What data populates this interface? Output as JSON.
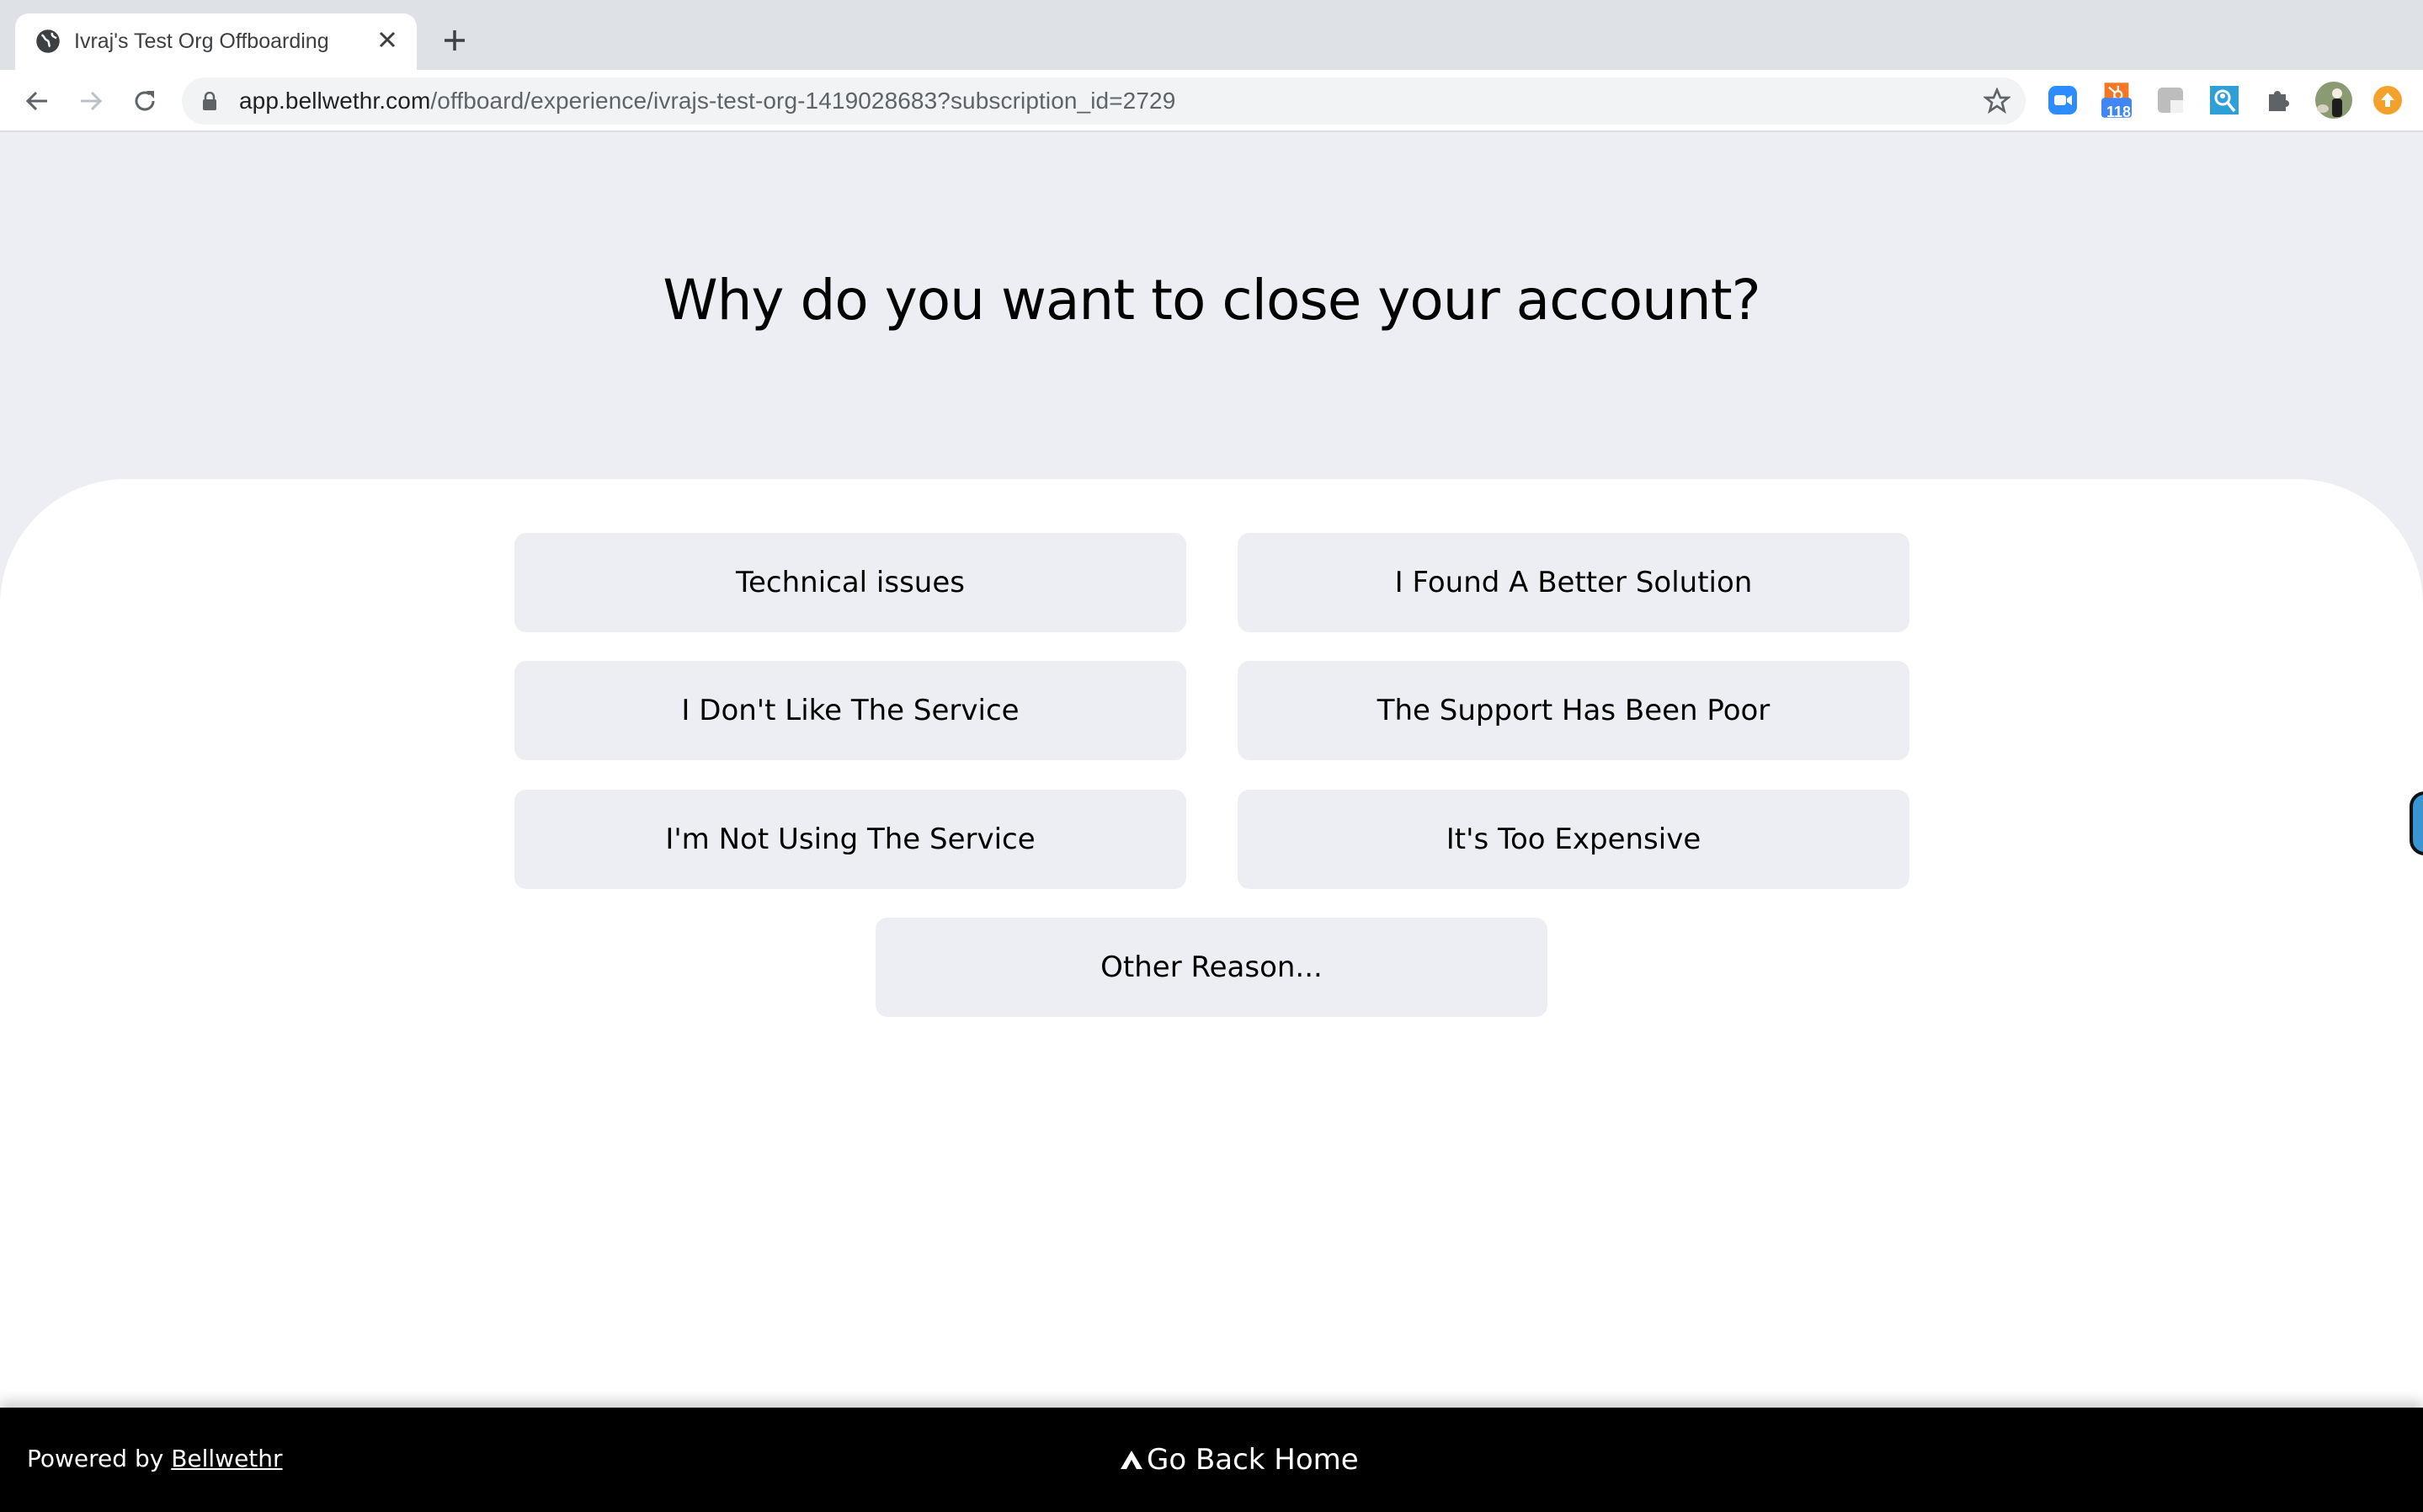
{
  "browser": {
    "tab": {
      "title": "Ivraj's Test Org Offboarding",
      "icon": "globe-icon",
      "close_icon": "close-icon"
    },
    "new_tab_icon": "plus-icon",
    "nav": {
      "back_icon": "arrow-left-icon",
      "forward_icon": "arrow-right-icon",
      "reload_icon": "reload-icon"
    },
    "address": {
      "host": "app.bellwethr.com",
      "path": "/offboard/experience/ivrajs-test-org-1419028683?subscription_id=2729",
      "lock_icon": "lock-icon",
      "bookmark_icon": "star-icon"
    },
    "extensions": [
      {
        "name": "zoom-extension",
        "icon": "video-camera-icon",
        "color": "#2d8cff"
      },
      {
        "name": "hubspot-extension",
        "icon": "hubspot-icon",
        "color": "#f57722",
        "badge": "118",
        "badge_color": "#4285f4"
      },
      {
        "name": "gray-extension",
        "icon": "square-icon",
        "color": "#bdbdbd"
      },
      {
        "name": "search-person-extension",
        "icon": "search-person-icon",
        "color": "#2e9fd8"
      },
      {
        "name": "extensions-menu",
        "icon": "puzzle-icon",
        "color": "#5f6368"
      },
      {
        "name": "profile-avatar",
        "icon": "avatar-icon",
        "color": "#7a8a6a"
      },
      {
        "name": "update-button",
        "icon": "arrow-up-circle-icon",
        "color": "#f4a12b"
      }
    ]
  },
  "page": {
    "heading": "Why do you want to close your account?",
    "reasons": [
      "Technical issues",
      "I Found A Better Solution",
      "I Don't Like The Service",
      "The Support Has Been Poor",
      "I'm Not Using The Service",
      "It's Too Expensive",
      "Other Reason..."
    ]
  },
  "footer": {
    "powered_prefix": "Powered by ",
    "powered_link": "Bellwethr",
    "go_home": "Go Back Home",
    "go_home_icon": "chevron-up-icon"
  },
  "colors": {
    "page_bg": "#eceef3",
    "button_bg": "#eceef3",
    "footer_bg": "#000000",
    "side_tab": "#3a96d2"
  }
}
